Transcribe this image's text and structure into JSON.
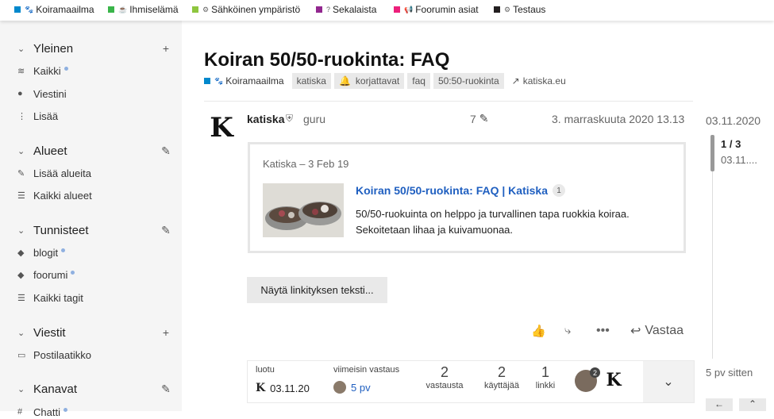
{
  "top_categories": [
    {
      "name": "Koiramaailma",
      "color": "#0088cc",
      "icon": "paw-icon",
      "icon_glyph": "🐾"
    },
    {
      "name": "Ihmiselämä",
      "color": "#3ab54a",
      "icon": "coffee-icon",
      "icon_glyph": "☕"
    },
    {
      "name": "Sähköinen ympäristö",
      "color": "#8ec63f",
      "icon": "cogs-icon",
      "icon_glyph": "⚙"
    },
    {
      "name": "Sekalaista",
      "color": "#92278f",
      "icon": "question-icon",
      "icon_glyph": "?"
    },
    {
      "name": "Foorumin asiat",
      "color": "#ed207b",
      "icon": "bullhorn-icon",
      "icon_glyph": "📢"
    },
    {
      "name": "Testaus",
      "color": "#231f20",
      "icon": "settings-icon",
      "icon_glyph": "⚙"
    }
  ],
  "sidebar": {
    "general": {
      "title": "Yleinen",
      "items": [
        "Kaikki",
        "Viestini",
        "Lisää"
      ]
    },
    "areas": {
      "title": "Alueet",
      "items": [
        "Lisää alueita",
        "Kaikki alueet"
      ]
    },
    "tags": {
      "title": "Tunnisteet",
      "items": [
        "blogit",
        "foorumi",
        "Kaikki tagit"
      ]
    },
    "messages": {
      "title": "Viestit",
      "items": [
        "Postilaatikko"
      ]
    },
    "channels": {
      "title": "Kanavat",
      "items": [
        "Chatti"
      ]
    }
  },
  "topic": {
    "title": "Koiran 50/50-ruokinta: FAQ",
    "category": "Koiramaailma",
    "category_color": "#0088cc",
    "tags": [
      "katiska",
      "korjattavat",
      "faq",
      "50:50-ruokinta"
    ],
    "alert_tag_color": "#e45735",
    "link": "katiska.eu"
  },
  "post": {
    "username": "katiska",
    "user_title": "guru",
    "edit_count": "7",
    "date": "3. marraskuuta 2020 13.13",
    "onebox": {
      "source": "Katiska – 3 Feb 19",
      "title": "Koiran 50/50-ruokinta: FAQ | Katiska",
      "badge": "1",
      "excerpt": "50/50-ruokuinta on helppo ja turvallinen tapa ruokkia koiraa. Sekoitetaan lihaa ja kuivamuonaa."
    },
    "show_link_button": "Näytä linkityksen teksti...",
    "reply_label": "Vastaa"
  },
  "summary": {
    "created_label": "luotu",
    "created_date": "03.11.20",
    "last_reply_label": "viimeisin vastaus",
    "last_reply_ago": "5 pv",
    "replies_num": "2",
    "replies_label": "vastausta",
    "users_num": "2",
    "users_label": "käyttäjää",
    "links_num": "1",
    "links_label": "linkki",
    "participant_badge": "2"
  },
  "timeline": {
    "start_date": "03.11.2020",
    "progress": "1 / 3",
    "progress_date": "03.11....",
    "end_label": "5 pv sitten"
  }
}
